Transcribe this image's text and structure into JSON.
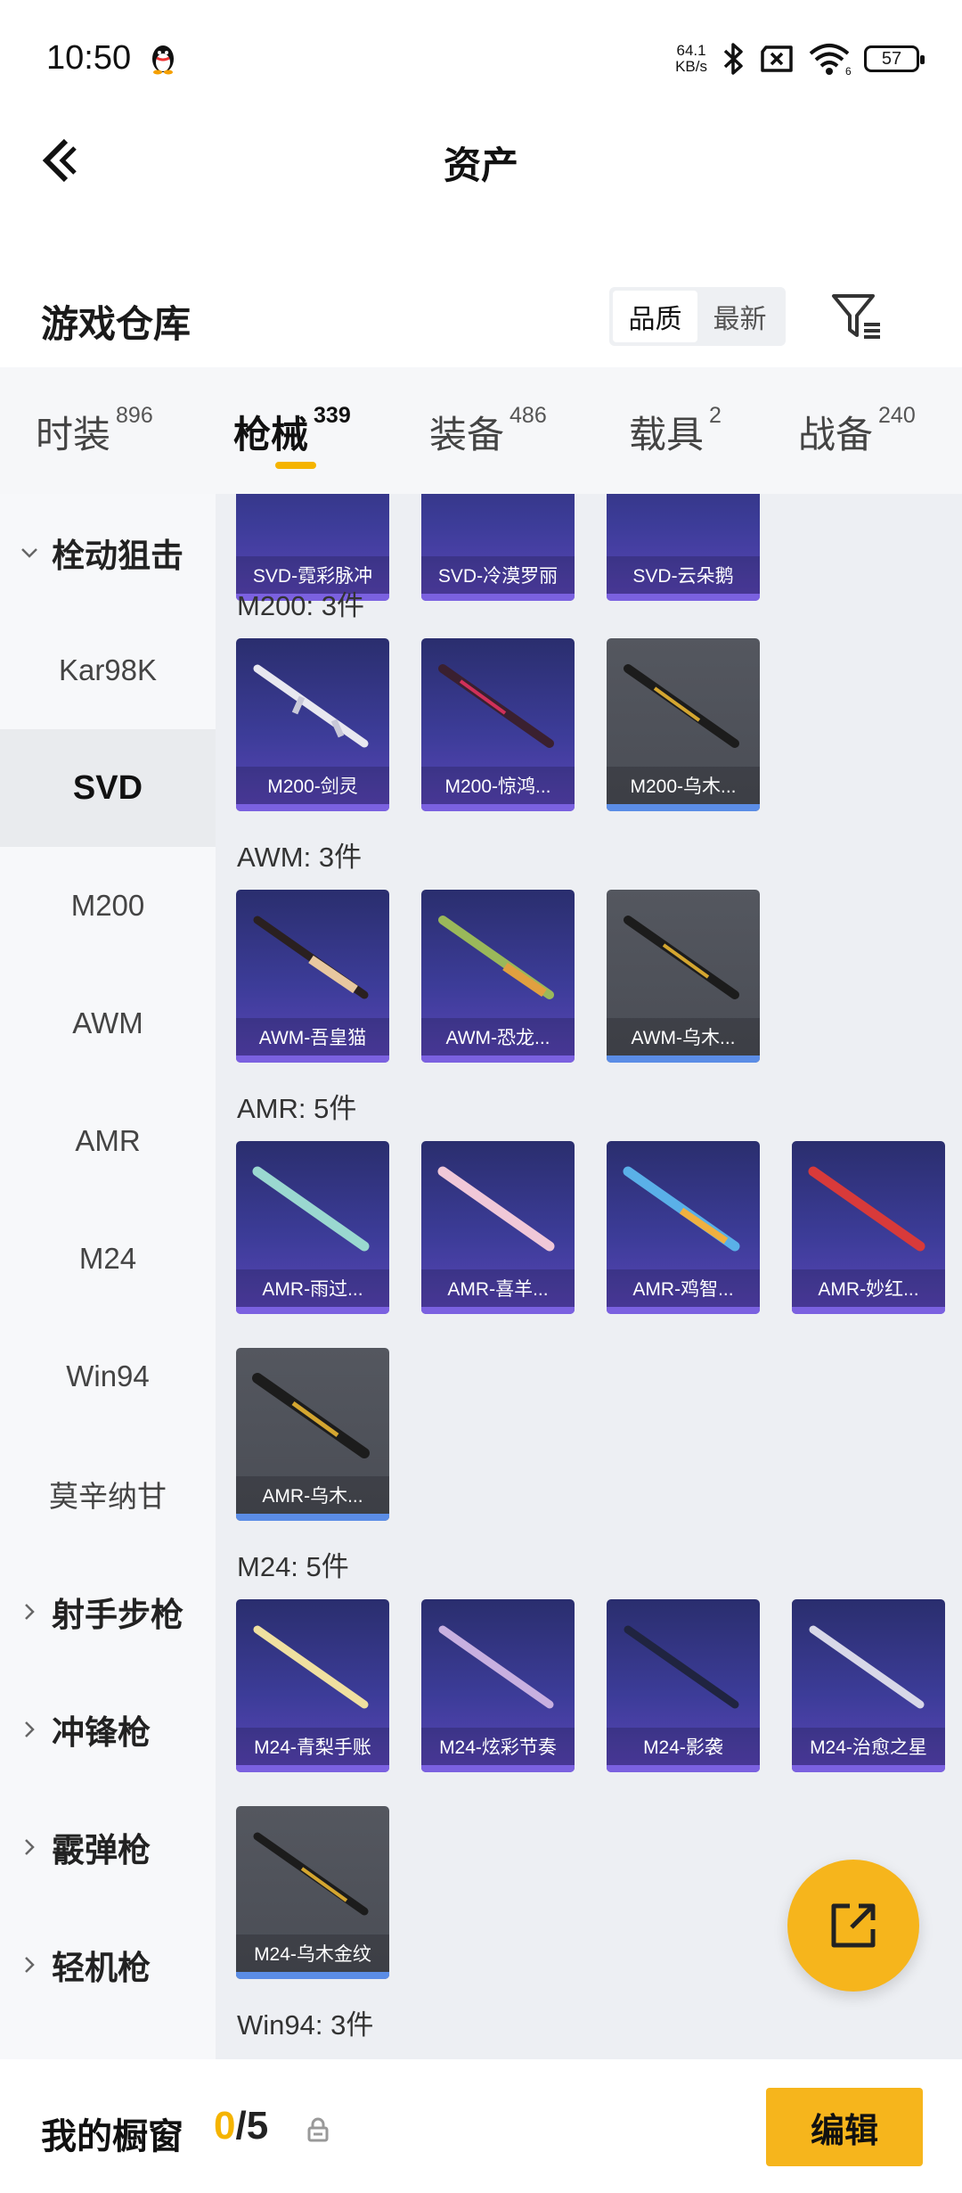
{
  "status_bar": {
    "time": "10:50",
    "net_speed_value": "64.1",
    "net_speed_unit": "KB/s",
    "wifi_badge": "6",
    "battery": "57"
  },
  "nav": {
    "title": "资产"
  },
  "warehouse": {
    "title": "游戏仓库",
    "sort_options": [
      "品质",
      "最新"
    ],
    "active_sort": "品质"
  },
  "tabs": [
    {
      "label": "时装",
      "count": "896"
    },
    {
      "label": "枪械",
      "count": "339",
      "active": true
    },
    {
      "label": "装备",
      "count": "486"
    },
    {
      "label": "载具",
      "count": "2"
    },
    {
      "label": "战备",
      "count": "240"
    }
  ],
  "sidebar": {
    "group_sniper": "栓动狙击",
    "sniper_items": [
      "Kar98K",
      "SVD",
      "M200",
      "AWM",
      "AMR",
      "M24",
      "Win94",
      "莫辛纳甘"
    ],
    "selected": "SVD",
    "group_marksman": "射手步枪",
    "group_smg": "冲锋枪",
    "group_shotgun": "霰弹枪",
    "group_lmg": "轻机枪"
  },
  "sections": {
    "svd_cards": [
      "SVD-霓彩脉冲",
      "SVD-冷漠罗丽",
      "SVD-云朵鹅"
    ],
    "m200": {
      "title": "M200: 3件",
      "cards": [
        "M200-剑灵",
        "M200-惊鸿...",
        "M200-乌木..."
      ]
    },
    "awm": {
      "title": "AWM: 3件",
      "cards": [
        "AWM-吾皇猫",
        "AWM-恐龙...",
        "AWM-乌木..."
      ]
    },
    "amr": {
      "title": "AMR: 5件",
      "cards": [
        "AMR-雨过...",
        "AMR-喜羊...",
        "AMR-鸡智...",
        "AMR-妙红...",
        "AMR-乌木..."
      ]
    },
    "m24": {
      "title": "M24: 5件",
      "cards": [
        "M24-青梨手账",
        "M24-炫彩节奏",
        "M24-影袭",
        "M24-治愈之星",
        "M24-乌木金纹"
      ]
    },
    "win94": {
      "title": "Win94: 3件"
    }
  },
  "bottom_bar": {
    "title": "我的橱窗",
    "showcase_used": "0",
    "showcase_total": "/5",
    "edit_label": "编辑"
  },
  "colors": {
    "accent": "#f6b51c",
    "card_purple": "#3c3c98",
    "card_gray": "#4a4d55"
  }
}
